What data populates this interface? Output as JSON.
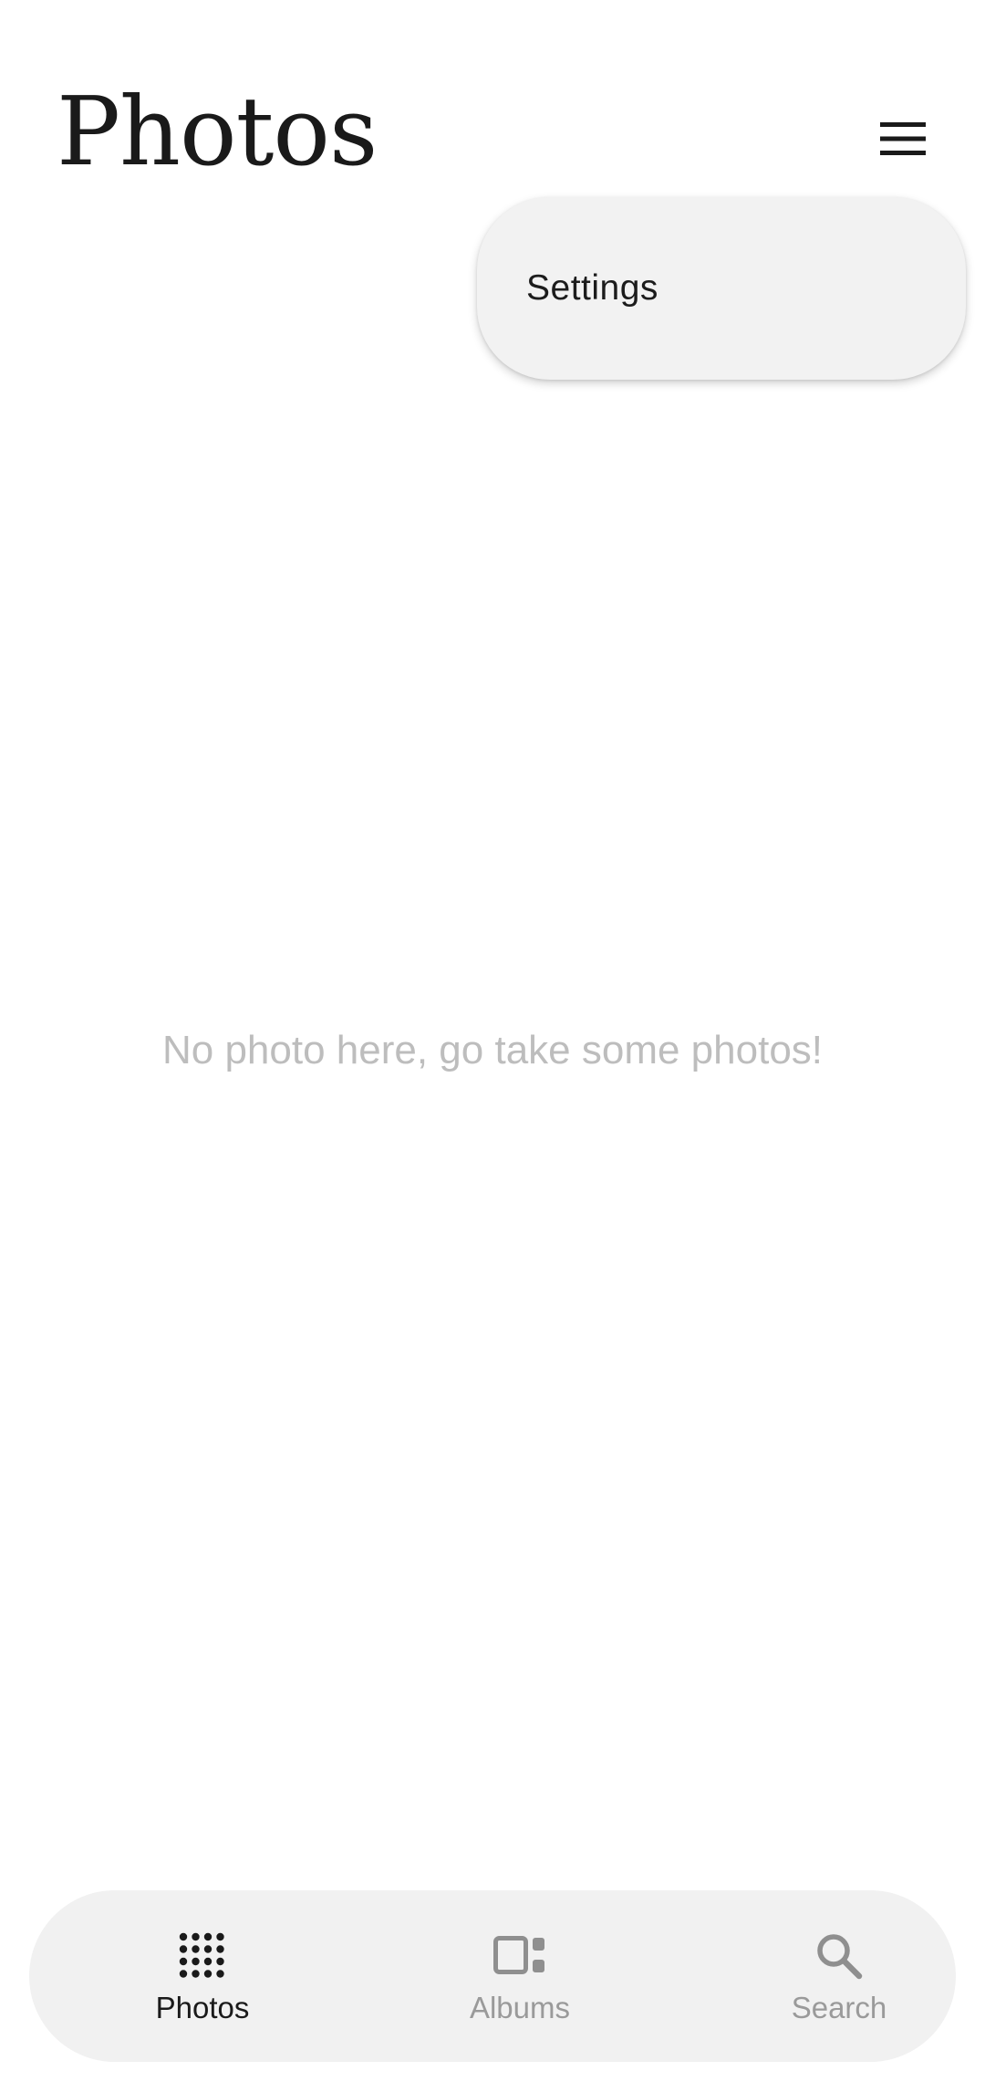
{
  "header": {
    "title": "Photos",
    "menu_icon": "hamburger-menu-icon"
  },
  "menu": {
    "items": [
      {
        "label": "Settings"
      }
    ]
  },
  "main": {
    "empty_message": "No photo here, go take some photos!"
  },
  "bottom_nav": {
    "tabs": [
      {
        "label": "Photos",
        "icon": "grid-dots-icon",
        "active": true
      },
      {
        "label": "Albums",
        "icon": "albums-icon",
        "active": false
      },
      {
        "label": "Search",
        "icon": "search-icon",
        "active": false
      }
    ]
  },
  "colors": {
    "background": "#ffffff",
    "surface": "#f1f1f1",
    "text_primary": "#1a1a1a",
    "text_muted": "#9a9a9a",
    "empty_text": "#bdbdbd"
  }
}
